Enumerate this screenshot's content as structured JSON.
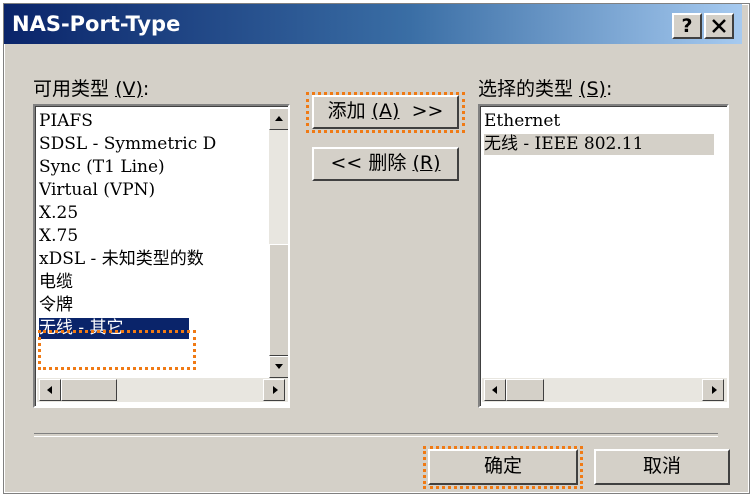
{
  "window": {
    "title": "NAS-Port-Type",
    "help_label": "?",
    "close_label": "×"
  },
  "available": {
    "label": "可用类型",
    "accel": "(V)",
    "suffix": ":",
    "items": [
      "PIAFS",
      "SDSL - Symmetric D",
      "Sync (T1 Line)",
      "Virtual (VPN)",
      "X.25",
      "X.75",
      "xDSL - 未知类型的数",
      "电缆",
      "令牌",
      "无线 - 其它"
    ],
    "selected_index": 9
  },
  "selected": {
    "label": "选择的类型",
    "accel": "(S)",
    "suffix": ":",
    "items": [
      "Ethernet",
      "无线 - IEEE 802.11"
    ],
    "selected_index": 1
  },
  "buttons": {
    "add_text": "添加",
    "add_accel": "(A)",
    "add_arrows": ">>",
    "remove_arrows": "<<",
    "remove_text": "删除",
    "remove_accel": "(R)",
    "ok": "确定",
    "cancel": "取消"
  },
  "colors": {
    "highlight": "#f07a14",
    "selection": "#0a246a",
    "dialog_bg": "#d4d0c8"
  }
}
